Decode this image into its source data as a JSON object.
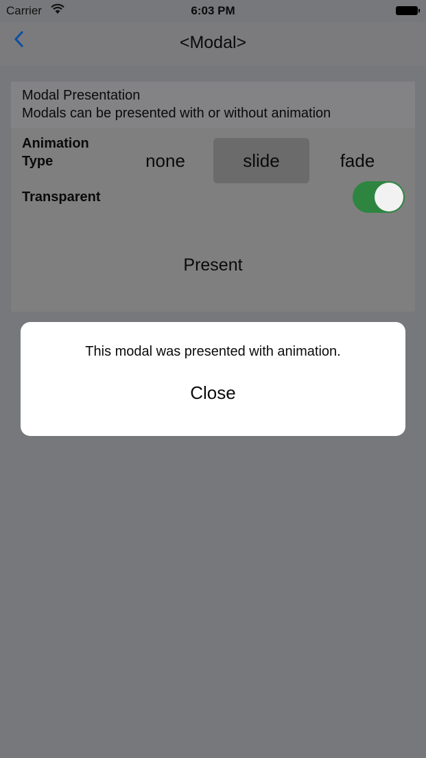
{
  "status_bar": {
    "carrier": "Carrier",
    "time": "6:03 PM"
  },
  "nav": {
    "back_icon": "chevron-left",
    "title": "<Modal>"
  },
  "card": {
    "header_title": "Modal Presentation",
    "header_subtitle": "Modals can be presented with or without animation",
    "animation_label": "Animation Type",
    "animation_options": [
      "none",
      "slide",
      "fade"
    ],
    "animation_selected": "slide",
    "transparent_label": "Transparent",
    "transparent_on": true,
    "present_label": "Present"
  },
  "modal": {
    "message": "This modal was presented with animation.",
    "close_label": "Close"
  },
  "colors": {
    "accent": "#0a4fa0",
    "toggle_on": "#2e8540"
  }
}
